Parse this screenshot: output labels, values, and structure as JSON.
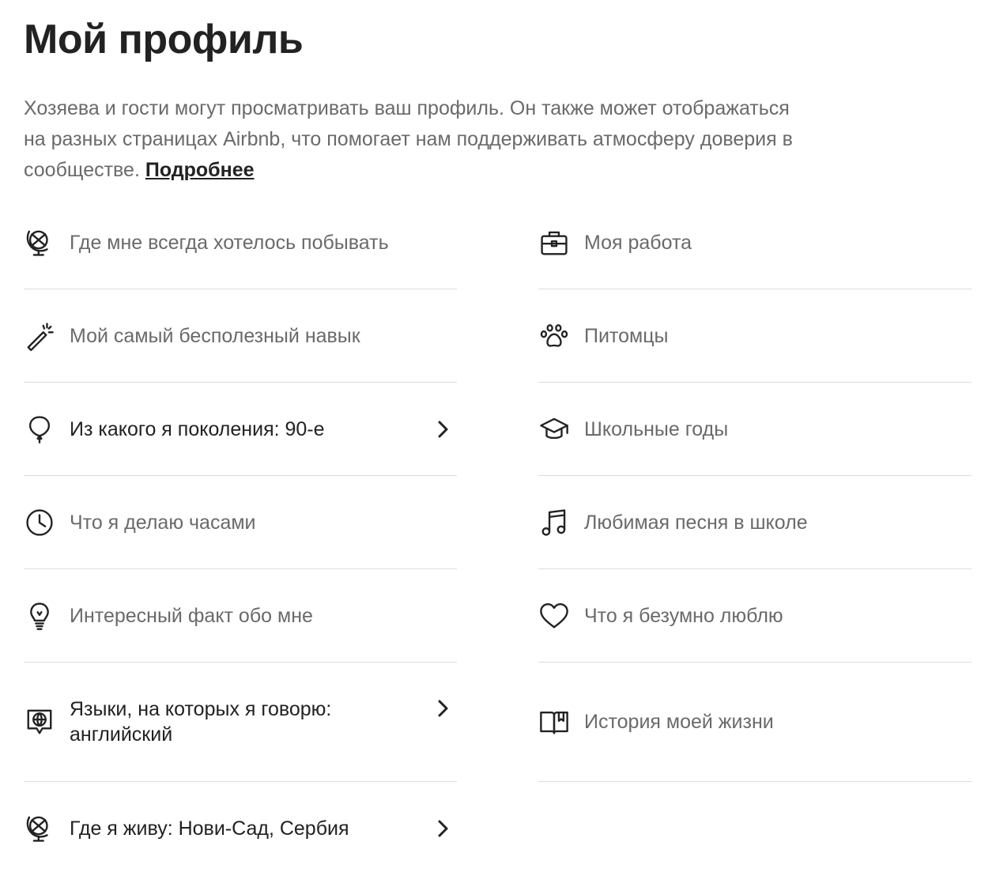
{
  "header": {
    "title": "Мой профиль",
    "intro_text": "Хозяева и гости могут просматривать ваш профиль. Он также может отображаться на разных страницах Airbnb, что помогает нам поддерживать атмосферу доверия в сообществе.",
    "learn_more_link": "Подробнее"
  },
  "left_column": {
    "items": [
      {
        "label": "Где мне всегда хотелось побывать",
        "icon": "globe-icon",
        "filled": false
      },
      {
        "label": "Мой самый бесполезный навык",
        "icon": "magic-wand-icon",
        "filled": false
      },
      {
        "label": "Из какого я поколения: 90-е",
        "icon": "balloon-icon",
        "filled": true
      },
      {
        "label": "Что я делаю часами",
        "icon": "clock-icon",
        "filled": false
      },
      {
        "label": "Интересный факт обо мне",
        "icon": "lightbulb-icon",
        "filled": false
      },
      {
        "label": "Языки, на которых я говорю: английский",
        "icon": "language-globe-icon",
        "filled": true
      },
      {
        "label": "Где я живу: Нови-Сад, Сербия",
        "icon": "globe-icon",
        "filled": true
      }
    ]
  },
  "right_column": {
    "items": [
      {
        "label": "Моя работа",
        "icon": "briefcase-icon",
        "filled": false
      },
      {
        "label": "Питомцы",
        "icon": "paw-icon",
        "filled": false
      },
      {
        "label": "Школьные годы",
        "icon": "graduation-cap-icon",
        "filled": false
      },
      {
        "label": "Любимая песня в школе",
        "icon": "music-note-icon",
        "filled": false
      },
      {
        "label": "Что я безумно люблю",
        "icon": "heart-icon",
        "filled": false
      },
      {
        "label": "История моей жизни",
        "icon": "book-icon",
        "filled": false
      }
    ]
  },
  "colors": {
    "primary_text": "#222222",
    "secondary_text": "#6a6a6a",
    "divider": "#dddddd"
  }
}
